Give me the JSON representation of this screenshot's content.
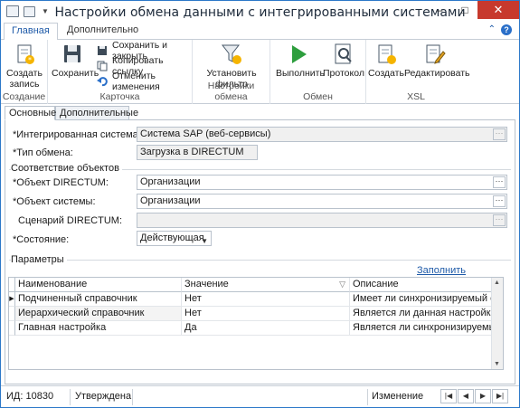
{
  "window": {
    "title": "Настройки обмена данными с интегрированными системами",
    "controls": {
      "minimize": "–",
      "maximize": "□",
      "close": "✕"
    }
  },
  "ribbon": {
    "tabs": [
      "Главная",
      "Дополнительно"
    ],
    "groups": {
      "create": {
        "label": "Создание",
        "new_record": [
          "Создать",
          "запись"
        ]
      },
      "card": {
        "label": "Карточка",
        "save": "Сохранить",
        "save_close": "Сохранить и закрыть",
        "copy_link": "Копировать ссылку",
        "undo": "Отменить изменения"
      },
      "exchange_settings": {
        "label": "Настройки обмена",
        "set_filter": [
          "Установить",
          "фильтр"
        ]
      },
      "exchange": {
        "label": "Обмен",
        "run": "Выполнить",
        "protocol": "Протокол"
      },
      "xsl": {
        "label": "XSL",
        "create": "Создать",
        "edit": "Редактировать"
      }
    }
  },
  "form": {
    "tabs": [
      "Основные",
      "Дополнительные"
    ],
    "integrated_system": {
      "label": "*Интегрированная система:",
      "value": "Система SAP (веб-сервисы)"
    },
    "exchange_type": {
      "label": "*Тип обмена:",
      "value": "Загрузка в DIRECTUM"
    },
    "mapping": {
      "title": "Соответствие объектов",
      "directum_object": {
        "label": "*Объект DIRECTUM:",
        "value": "Организации"
      },
      "system_object": {
        "label": "*Объект системы:",
        "value": "Организации"
      },
      "directum_scenario": {
        "label": "Сценарий DIRECTUM:",
        "value": ""
      },
      "state": {
        "label": "*Состояние:",
        "value": "Действующая"
      }
    },
    "parameters": {
      "title": "Параметры",
      "fill_link": "Заполнить параметры",
      "columns": [
        "Наименование",
        "Значение",
        "Описание"
      ],
      "rows": [
        [
          "Подчиненный справочник",
          "Нет",
          "Имеет ли синхронизируемый справоч"
        ],
        [
          "Иерархический справочник",
          "Нет",
          "Является ли данная настройка главной"
        ],
        [
          "Главная настройка",
          "Да",
          "Является ли синхронизируемый справ"
        ]
      ]
    }
  },
  "statusbar": {
    "id": "ИД: 10830",
    "state": "Утверждена",
    "mode": "Изменение"
  },
  "colors": {
    "accent": "#1e5aa8",
    "close": "#c7392d",
    "border": "#b9c2cc"
  }
}
